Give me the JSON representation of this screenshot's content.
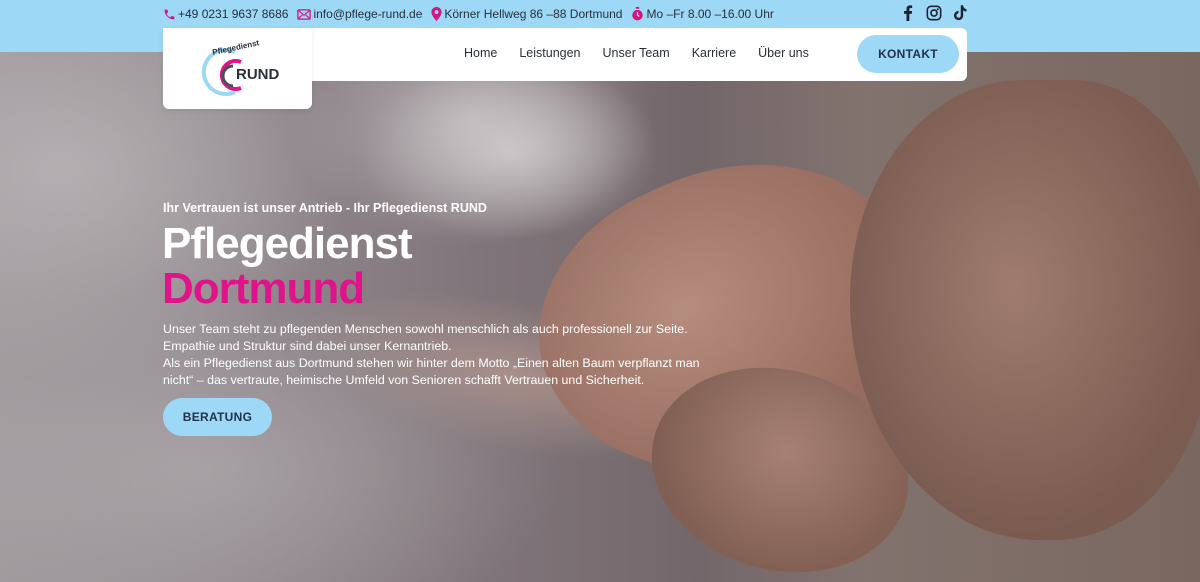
{
  "topbar": {
    "phone": "+49 0231 9637 8686",
    "email": "info@pflege-rund.de",
    "address": "Körner Hellweg 86 –88 Dortmund",
    "hours": "Mo –Fr 8.00 –16.00 Uhr",
    "icons": {
      "phone": "phone-icon",
      "email": "mail-icon",
      "address": "location-pin-icon",
      "hours": "clock-icon"
    },
    "socials": [
      "facebook-icon",
      "instagram-icon",
      "tiktok-icon"
    ]
  },
  "logo": {
    "top_text": "Pflegedienst",
    "brand": "RUND"
  },
  "nav": {
    "items": [
      "Home",
      "Leistungen",
      "Unser Team",
      "Karriere",
      "Über uns"
    ]
  },
  "header": {
    "cta_label": "KONTAKT"
  },
  "hero": {
    "subtitle": "Ihr Vertrauen ist unser Antrieb - Ihr Pflegedienst RUND",
    "title_line1": "Pflegedienst",
    "title_line2": "Dortmund",
    "description": [
      "Unser Team steht zu pflegenden Menschen sowohl menschlich als auch professionell zur Seite.",
      "Empathie und Struktur sind dabei unser Kernantrieb.",
      "Als ein Pflegedienst aus Dortmund stehen wir hinter dem Motto „Einen alten Baum verpflanzt man",
      "nicht“ – das vertraute, heimische Umfeld von Senioren schafft Vertrauen und Sicherheit."
    ],
    "cta_label": "BERATUNG"
  },
  "colors": {
    "accent_blue": "#9dd8f6",
    "brand_pink": "#e0148a",
    "text_dark": "#2b2f38"
  }
}
